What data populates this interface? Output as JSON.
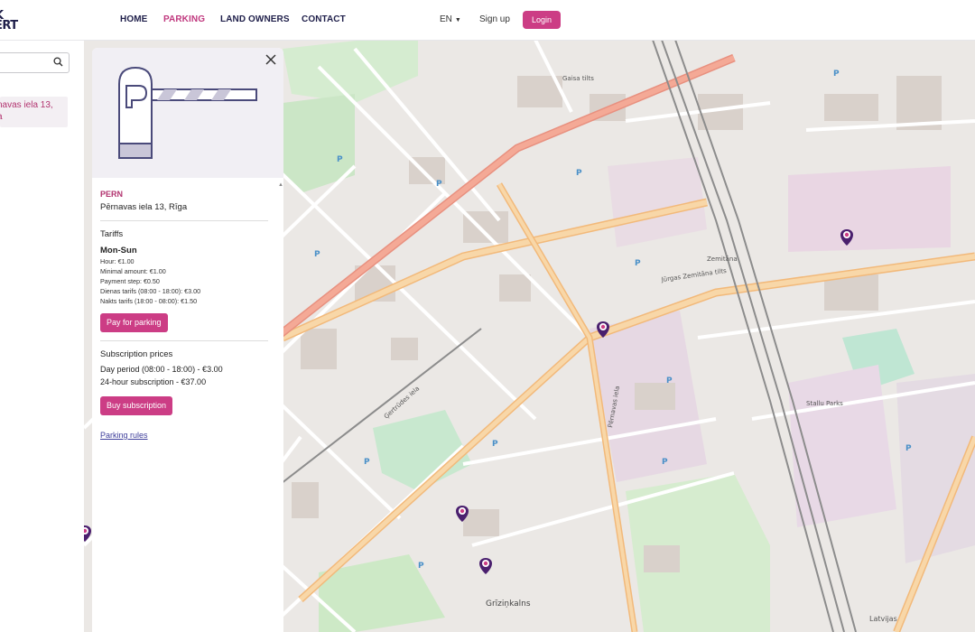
{
  "header": {
    "logo_line1": "K",
    "logo_line2": "ERT",
    "nav": [
      {
        "label": "HOME",
        "active": false
      },
      {
        "label": "PARKING",
        "active": true
      },
      {
        "label": "LAND OWNERS",
        "active": false
      },
      {
        "label": "CONTACT",
        "active": false
      }
    ],
    "language": "EN",
    "signup": "Sign up",
    "login": "Login"
  },
  "sidebar": {
    "search_placeholder": "",
    "result_line1": "navas iela 13,",
    "result_line2": "a"
  },
  "card": {
    "code": "PERN",
    "address": "Pērnavas iela 13, Rīga",
    "tariffs_title": "Tariffs",
    "days": "Mon-Sun",
    "tariff_lines": [
      "Hour: €1.00",
      "Minimal amount: €1.00",
      "Payment step: €0.50",
      "Dienas tarifs (08:00 - 18:00): €3.00",
      "Nakts tarifs (18:00 - 08:00): €1.50"
    ],
    "pay_button": "Pay for parking",
    "subscription_title": "Subscription prices",
    "subscription_lines": [
      "Day period (08:00 - 18:00) - €3.00",
      "24-hour subscription - €37.00"
    ],
    "buy_button": "Buy subscription",
    "rules_link": "Parking rules"
  },
  "map": {
    "labels": {
      "gertrudes": "Ģertrūdes iela",
      "pernavas": "Pērnavas iela",
      "grizinkalns": "Grīziņkalns",
      "gaisa": "Gaisa tilts",
      "jura": "Jūrgas Zemitāna tilts",
      "zemitana": "Zemitāna",
      "latvijas": "Latvijas",
      "stacija": "Stallu Parks"
    },
    "colors": {
      "accent": "#cc3d85",
      "pin": "#4a1f6e",
      "major_road": "#f6c98f",
      "railway": "#9a9a9a",
      "park": "#cdebc8"
    }
  }
}
